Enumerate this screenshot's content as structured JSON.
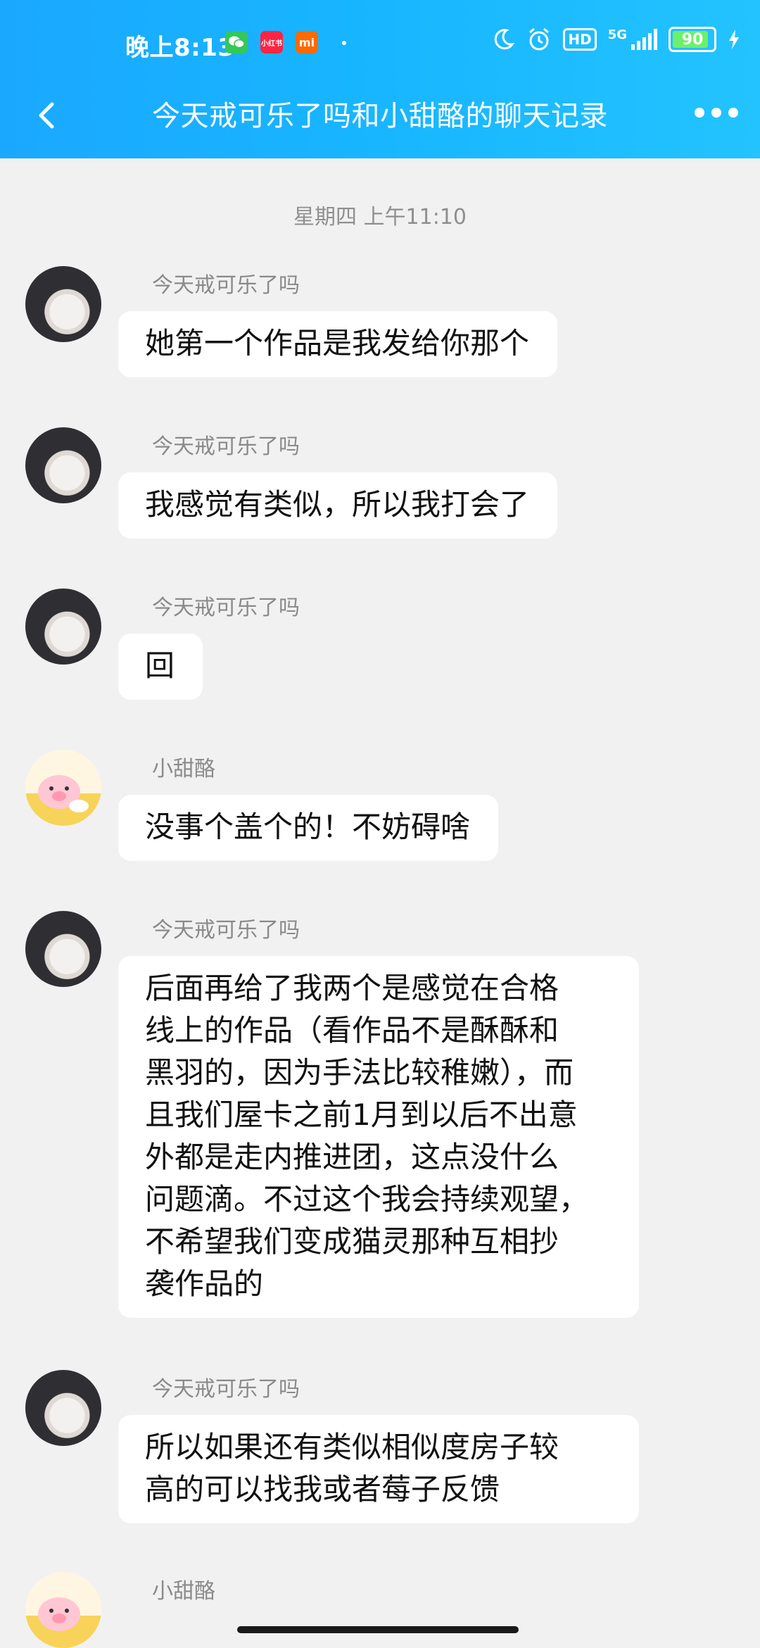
{
  "status_bar": {
    "time": "晚上8:13",
    "dot": "·",
    "hd": "HD",
    "network": "5G",
    "battery": "90",
    "battery_level_percent": 90,
    "icons": [
      "wechat-icon",
      "xiaohongshu-icon",
      "mi-icon",
      "moon-icon",
      "alarm-icon",
      "hd-icon",
      "signal-icon",
      "battery-icon",
      "charging-icon"
    ],
    "app_icon_labels": {
      "xiaohongshu": "小红书",
      "mi": "mi"
    }
  },
  "header": {
    "title": "今天戒可乐了吗和小甜酪的聊天记录",
    "back_icon": "chevron-left-icon",
    "more_icon": "more-dots-icon"
  },
  "chat": {
    "timestamp": "星期四 上午11:10",
    "messages": [
      {
        "sender": "今天戒可乐了吗",
        "avatar": "girl-avatar",
        "text": "她第一个作品是我发给你那个"
      },
      {
        "sender": "今天戒可乐了吗",
        "avatar": "girl-avatar",
        "text": "我感觉有类似，所以我打会了"
      },
      {
        "sender": "今天戒可乐了吗",
        "avatar": "girl-avatar",
        "text": "回"
      },
      {
        "sender": "小甜酪",
        "avatar": "pig-avatar",
        "text": "没事个盖个的！不妨碍啥"
      },
      {
        "sender": "今天戒可乐了吗",
        "avatar": "girl-avatar",
        "text": "后面再给了我两个是感觉在合格\n线上的作品（看作品不是酥酥和\n黑羽的，因为手法比较稚嫩），而\n且我们屋卡之前1月到以后不出意\n外都是走内推进团，这点没什么\n问题滴。不过这个我会持续观望，\n不希望我们变成猫灵那种互相抄\n袭作品的"
      },
      {
        "sender": "今天戒可乐了吗",
        "avatar": "girl-avatar",
        "text": "所以如果还有类似相似度房子较\n高的可以找我或者莓子反馈"
      },
      {
        "sender": "小甜酪",
        "avatar": "pig-avatar",
        "text": ""
      }
    ]
  },
  "colors": {
    "header_start": "#1aa8ff",
    "header_end": "#23c3ff",
    "background": "#f1f1f1",
    "bubble": "#ffffff"
  }
}
